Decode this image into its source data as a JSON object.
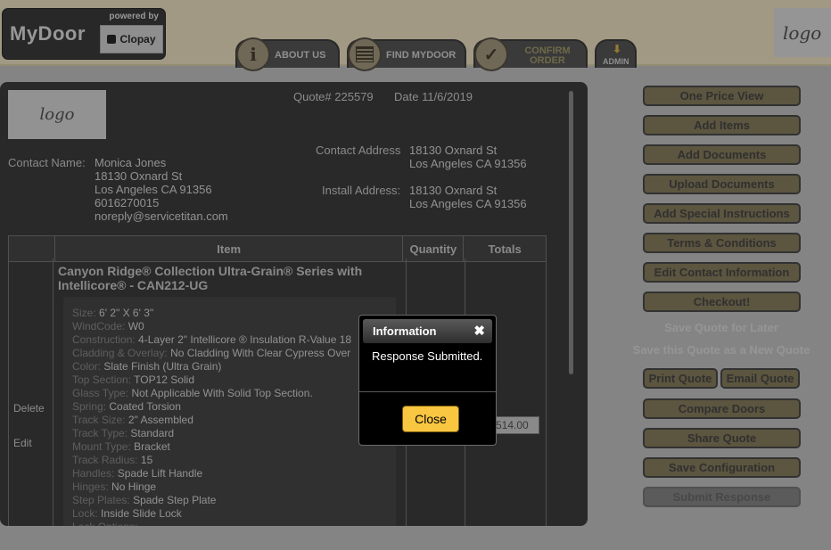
{
  "header": {
    "brand_name": "MyDoor",
    "powered_by": "powered by",
    "clopay": "Clopay",
    "logo_text": "logo",
    "nav": {
      "about": "ABOUT US",
      "find": "FIND MYDOOR",
      "confirm": "CONFIRM ORDER",
      "admin": "ADMIN"
    }
  },
  "quote": {
    "logo_text": "logo",
    "number": "Quote# 225579",
    "date": "Date 11/6/2019",
    "contact_name_label": "Contact Name:",
    "contact_name_lines": [
      "Monica Jones",
      "18130 Oxnard St",
      "Los Angeles CA 91356",
      "6016270015",
      "noreply@servicetitan.com"
    ],
    "contact_address_label": "Contact Address",
    "contact_address_lines": [
      "18130 Oxnard St",
      "Los Angeles CA 91356"
    ],
    "install_address_label": "Install Address:",
    "install_address_lines": [
      "18130 Oxnard St",
      "Los Angeles CA 91356"
    ]
  },
  "table": {
    "headers": [
      "",
      "Item",
      "Quantity",
      "Totals"
    ],
    "actions": {
      "delete": "Delete",
      "edit": "Edit"
    },
    "item_title": "Canyon Ridge® Collection Ultra-Grain® Series with Intellicore® - CAN212-UG",
    "specs": [
      {
        "k": "Size:",
        "v": "6' 2\" X 6' 3\""
      },
      {
        "k": "WindCode:",
        "v": "W0"
      },
      {
        "k": "Construction:",
        "v": "4-Layer 2\" Intellicore ® Insulation R-Value 18"
      },
      {
        "k": "Cladding & Overlay:",
        "v": "No Cladding With Clear Cypress Over"
      },
      {
        "k": "Color:",
        "v": "Slate Finish (Ultra Grain)"
      },
      {
        "k": "Top Section:",
        "v": "TOP12 Solid"
      },
      {
        "k": "Glass Type:",
        "v": "Not Applicable With Solid Top Section."
      },
      {
        "k": "Spring:",
        "v": "Coated Torsion"
      },
      {
        "k": "Track Size:",
        "v": "2\" Assembled"
      },
      {
        "k": "Track Type:",
        "v": "Standard"
      },
      {
        "k": "Mount Type:",
        "v": "Bracket"
      },
      {
        "k": "Track Radius:",
        "v": "15"
      },
      {
        "k": "Handles:",
        "v": "Spade Lift Handle"
      },
      {
        "k": "Hinges:",
        "v": "No Hinge"
      },
      {
        "k": "Step Plates:",
        "v": "Spade Step Plate"
      },
      {
        "k": "Lock:",
        "v": "Inside Slide Lock"
      },
      {
        "k": "Lock Options:",
        "v": ""
      }
    ],
    "total_value": "514.00"
  },
  "sidebar": {
    "one_price_view": "One Price View",
    "add_items": "Add Items",
    "add_documents": "Add Documents",
    "upload_documents": "Upload Documents",
    "add_special": "Add Special Instructions",
    "terms": "Terms & Conditions",
    "edit_contact": "Edit Contact Information",
    "checkout": "Checkout!",
    "save_later": "Save Quote for Later",
    "save_new": "Save this Quote as a New Quote",
    "print_quote": "Print Quote",
    "email_quote": "Email Quote",
    "compare_doors": "Compare Doors",
    "share_quote": "Share Quote",
    "save_config": "Save Configuration",
    "submit_response": "Submit Response"
  },
  "dialog": {
    "title": "Information",
    "close_x": "✖",
    "message": "Response Submitted.",
    "close_button": "Close"
  }
}
